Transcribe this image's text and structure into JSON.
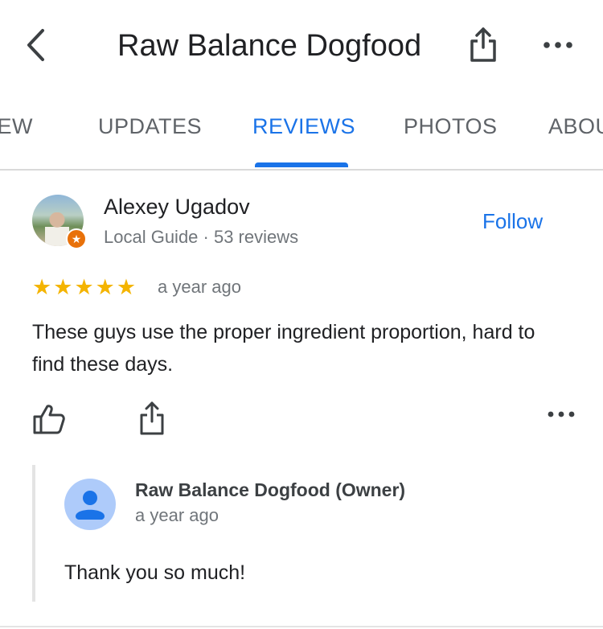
{
  "header": {
    "title": "Raw Balance Dogfood",
    "back_icon": "chevron-left-icon",
    "share_icon": "share-icon",
    "more_icon": "more-horizontal-icon"
  },
  "tabs": [
    {
      "label": "VIEW",
      "active": false
    },
    {
      "label": "UPDATES",
      "active": false
    },
    {
      "label": "REVIEWS",
      "active": true
    },
    {
      "label": "PHOTOS",
      "active": false
    },
    {
      "label": "ABOUT",
      "active": false
    }
  ],
  "review": {
    "reviewer_name": "Alexey Ugadov",
    "reviewer_meta": "Local Guide · 53 reviews",
    "follow_label": "Follow",
    "rating": 5,
    "stars": [
      "★",
      "★",
      "★",
      "★",
      "★"
    ],
    "time": "a year ago",
    "text": "These guys use the proper ingredient proportion, hard to find these days.",
    "badge_glyph": "★"
  },
  "reply": {
    "owner_name": "Raw Balance Dogfood (Owner)",
    "time": "a year ago",
    "text": "Thank you so much!"
  },
  "colors": {
    "accent": "#1a73e8",
    "star": "#f4b400",
    "secondary_text": "#70757a",
    "badge": "#e8710a"
  }
}
